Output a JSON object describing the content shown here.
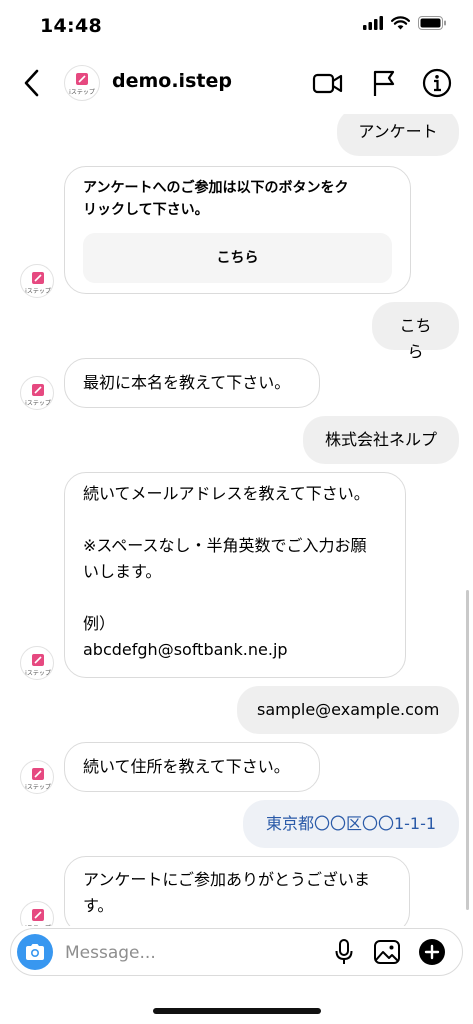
{
  "status_bar": {
    "time": "14:48"
  },
  "header": {
    "contact_name": "demo.istep",
    "avatar_text": "iステップ",
    "icons": [
      "back-arrow-icon",
      "video-call-icon",
      "flag-icon",
      "info-icon"
    ]
  },
  "messages": [
    {
      "from": "me",
      "text": "アンケート"
    },
    {
      "from": "bot",
      "type": "card",
      "text_lines": [
        "アンケートへのご参加は以下のボタンをク",
        "リックして下さい。"
      ],
      "button": "こちら"
    },
    {
      "from": "me",
      "text": "こちら"
    },
    {
      "from": "bot",
      "text": "最初に本名を教えて下さい。"
    },
    {
      "from": "me",
      "text": "株式会社ネルプ"
    },
    {
      "from": "bot",
      "text_lines": [
        "続いてメールアドレスを教えて下さい。",
        "",
        "※スペースなし・半角英数でご入力お願",
        "いします。",
        "",
        "例）",
        "abcdefgh@softbank.ne.jp"
      ]
    },
    {
      "from": "me",
      "text": "sample@example.com"
    },
    {
      "from": "bot",
      "text": "続いて住所を教えて下さい。"
    },
    {
      "from": "me",
      "text": "東京都〇〇区〇〇1-1-1",
      "style": "link"
    },
    {
      "from": "bot",
      "text_lines": [
        "アンケートにご参加ありがとうございま",
        "す。"
      ]
    }
  ],
  "composer": {
    "placeholder": "Message...",
    "icons": [
      "camera-icon",
      "microphone-icon",
      "gallery-icon",
      "add-icon"
    ]
  },
  "colors": {
    "accent": "#3897f0",
    "out_bubble": "#efefef",
    "link_text": "#2a5aa8",
    "logo_pink": "#e64980"
  }
}
